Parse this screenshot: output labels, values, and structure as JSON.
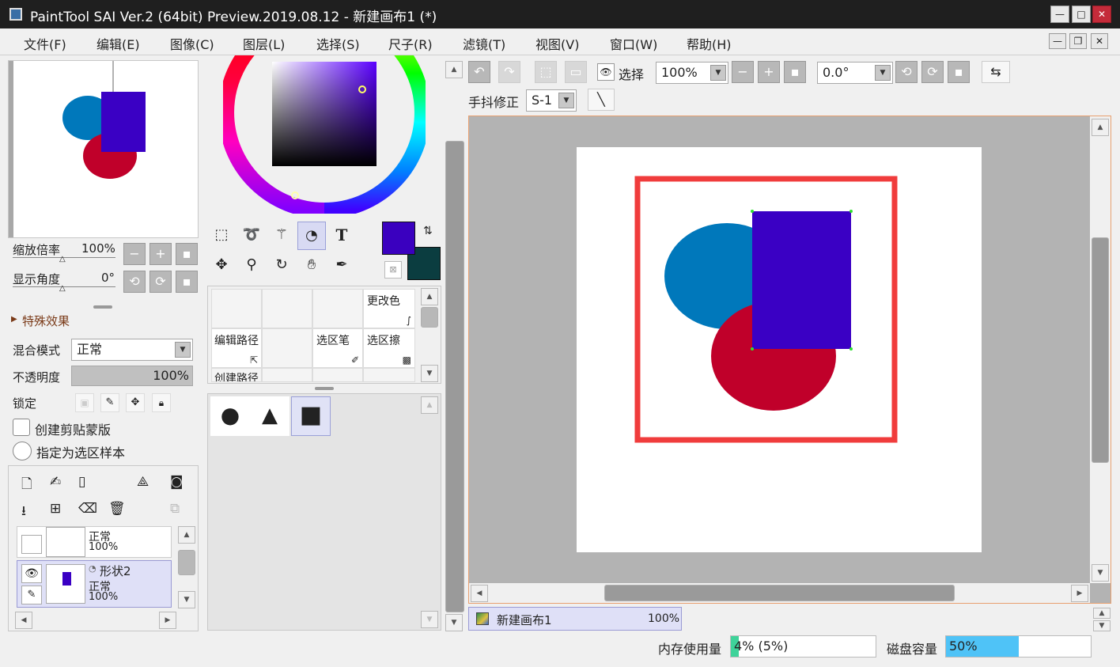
{
  "window": {
    "title": "PaintTool SAI Ver.2 (64bit) Preview.2019.08.12 - 新建画布1 (*)",
    "minimize": "—",
    "maximize": "□",
    "close": "✕"
  },
  "menus": [
    "文件(F)",
    "编辑(E)",
    "图像(C)",
    "图层(L)",
    "选择(S)",
    "尺子(R)",
    "滤镜(T)",
    "视图(V)",
    "窗口(W)",
    "帮助(H)"
  ],
  "mdi": {
    "min": "—",
    "restore": "❐",
    "close": "✕"
  },
  "navigator": {
    "zoom_label": "缩放倍率",
    "zoom_value": "100%",
    "angle_label": "显示角度",
    "angle_value": "0°"
  },
  "effects": {
    "label": "特殊效果"
  },
  "layer_props": {
    "blend_label": "混合模式",
    "blend_value": "正常",
    "opacity_label": "不透明度",
    "opacity_value": "100%",
    "opacity": 1.0,
    "lock_label": "锁定",
    "clip_label": "创建剪贴蒙版",
    "selsrc_label": "指定为选区样本"
  },
  "layers": [
    {
      "name": "",
      "mode": "正常",
      "opacity": "100%"
    },
    {
      "name": "形状2",
      "mode": "正常",
      "opacity": "100%"
    }
  ],
  "colors": {
    "primary": "#3a00bf",
    "secondary": "#0b3d40",
    "canvas_bg": "#b3b3b3",
    "blue_ellipse": "#0078bb",
    "red_ellipse": "#c0002a",
    "rect": "#3a00c4",
    "frame": "#f03c3c"
  },
  "tools": {
    "text": "T"
  },
  "tool_cells": {
    "change_color": "更改色",
    "edit_path": "编辑路径",
    "select_pen": "选区笔",
    "select_eraser": "选区擦",
    "create_path": "创建路径"
  },
  "shapes": {
    "circle": "●",
    "triangle": "▲",
    "square": "■"
  },
  "toolbar": {
    "select_label": "选择",
    "zoom": "100%",
    "angle": "0.0°",
    "stabilizer_label": "手抖修正",
    "stabilizer": "S-1"
  },
  "doc_tab": {
    "name": "新建画布1",
    "zoom": "100%"
  },
  "status": {
    "memory_label": "内存使用量",
    "memory_value": "4% (5%)",
    "memory_fill": 0.04,
    "disk_label": "磁盘容量",
    "disk_value": "50%",
    "disk_fill": 0.5
  }
}
